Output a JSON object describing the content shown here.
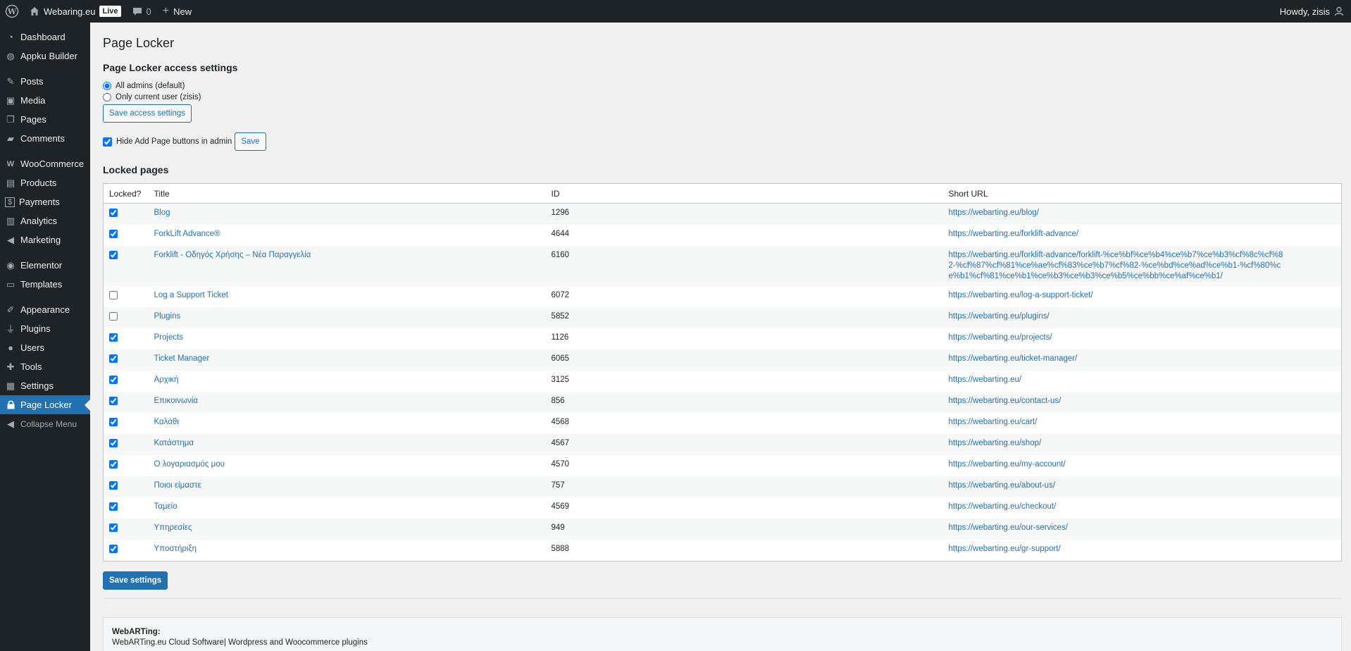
{
  "adminbar": {
    "site_name": "Webaring.eu",
    "live_badge": "Live",
    "comments_count": "0",
    "new_label": "New",
    "howdy": "Howdy, zisis"
  },
  "sidebar": {
    "items": [
      {
        "label": "Dashboard",
        "icon": "dashboard-icon"
      },
      {
        "label": "Appku Builder",
        "icon": "globe-icon"
      },
      {
        "label": "Posts",
        "icon": "pin-icon"
      },
      {
        "label": "Media",
        "icon": "media-icon"
      },
      {
        "label": "Pages",
        "icon": "pages-icon"
      },
      {
        "label": "Comments",
        "icon": "comment-icon"
      },
      {
        "label": "WooCommerce",
        "icon": "woo-icon"
      },
      {
        "label": "Products",
        "icon": "archive-icon"
      },
      {
        "label": "Payments",
        "icon": "dollar-icon"
      },
      {
        "label": "Analytics",
        "icon": "bar-chart-icon"
      },
      {
        "label": "Marketing",
        "icon": "megaphone-icon"
      },
      {
        "label": "Elementor",
        "icon": "elementor-icon"
      },
      {
        "label": "Templates",
        "icon": "folder-icon"
      },
      {
        "label": "Appearance",
        "icon": "brush-icon"
      },
      {
        "label": "Plugins",
        "icon": "plug-icon"
      },
      {
        "label": "Users",
        "icon": "user-icon"
      },
      {
        "label": "Tools",
        "icon": "wrench-icon"
      },
      {
        "label": "Settings",
        "icon": "settings-icon"
      },
      {
        "label": "Page Locker",
        "icon": "lock-icon"
      },
      {
        "label": "Collapse Menu",
        "icon": "collapse-icon"
      }
    ]
  },
  "main": {
    "title": "Page Locker",
    "access_heading": "Page Locker access settings",
    "radio_all": "All admins (default)",
    "radio_current": "Only current user (zisis)",
    "save_access": "Save access settings",
    "hide_add_label": "Hide Add Page buttons in admin",
    "save_label": "Save",
    "locked_heading": "Locked pages",
    "columns": [
      "Locked?",
      "Title",
      "ID",
      "Short URL"
    ],
    "rows": [
      {
        "checked": true,
        "title": "Blog",
        "id": "1296",
        "url": "https://webarting.eu/blog/"
      },
      {
        "checked": true,
        "title": "ForkLift Advance®",
        "id": "4644",
        "url": "https://webarting.eu/forklift-advance/"
      },
      {
        "checked": true,
        "title": "Forklift - Οδηγός Χρήσης – Νέα Παραγγελία",
        "id": "6160",
        "url": "https://webarting.eu/forklift-advance/forklift-%ce%bf%ce%b4%ce%b7%ce%b3%cf%8c%cf%82-%cf%87%cf%81%ce%ae%cf%83%ce%b7%cf%82-%ce%bd%ce%ad%ce%b1-%cf%80%ce%b1%cf%81%ce%b1%ce%b3%ce%b3%ce%b5%ce%bb%ce%af%ce%b1/"
      },
      {
        "checked": false,
        "title": "Log a Support Ticket",
        "id": "6072",
        "url": "https://webarting.eu/log-a-support-ticket/"
      },
      {
        "checked": false,
        "title": "Plugins",
        "id": "5852",
        "url": "https://webarting.eu/plugins/"
      },
      {
        "checked": true,
        "title": "Projects",
        "id": "1126",
        "url": "https://webarting.eu/projects/"
      },
      {
        "checked": true,
        "title": "Ticket Manager",
        "id": "6065",
        "url": "https://webarting.eu/ticket-manager/"
      },
      {
        "checked": true,
        "title": "Αρχική",
        "id": "3125",
        "url": "https://webarting.eu/"
      },
      {
        "checked": true,
        "title": "Επικοινωνία",
        "id": "856",
        "url": "https://webarting.eu/contact-us/"
      },
      {
        "checked": true,
        "title": "Καλάθι",
        "id": "4568",
        "url": "https://webarting.eu/cart/"
      },
      {
        "checked": true,
        "title": "Κατάστημα",
        "id": "4567",
        "url": "https://webarting.eu/shop/"
      },
      {
        "checked": true,
        "title": "Ο λογαριασμός μου",
        "id": "4570",
        "url": "https://webarting.eu/my-account/"
      },
      {
        "checked": true,
        "title": "Ποιοι είμαστε",
        "id": "757",
        "url": "https://webarting.eu/about-us/"
      },
      {
        "checked": true,
        "title": "Ταμείο",
        "id": "4569",
        "url": "https://webarting.eu/checkout/"
      },
      {
        "checked": true,
        "title": "Υπηρεσίες",
        "id": "949",
        "url": "https://webarting.eu/our-services/"
      },
      {
        "checked": true,
        "title": "Υποστήριξη",
        "id": "5888",
        "url": "https://webarting.eu/gr-support/"
      }
    ],
    "save_settings": "Save settings",
    "footer_brand": "WebARTing:",
    "footer_text": "WebARTing.eu Cloud Software| Wordpress and Woocommerce plugins"
  }
}
